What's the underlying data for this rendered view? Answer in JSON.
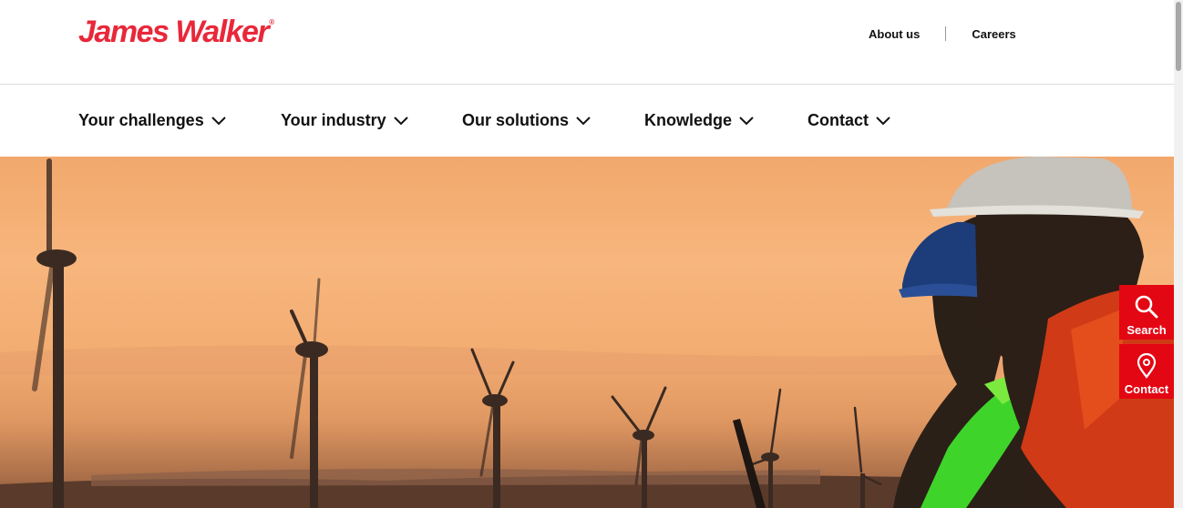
{
  "brand": {
    "logo_text": "James Walker",
    "logo_mark": "®",
    "color": "#e8283a"
  },
  "utility_nav": {
    "about": "About us",
    "careers": "Careers"
  },
  "main_nav": [
    {
      "label": "Your challenges",
      "icon": "chevron-down-icon"
    },
    {
      "label": "Your industry",
      "icon": "chevron-down-icon"
    },
    {
      "label": "Our solutions",
      "icon": "chevron-down-icon"
    },
    {
      "label": "Knowledge",
      "icon": "chevron-down-icon"
    },
    {
      "label": "Contact",
      "icon": "chevron-down-icon"
    }
  ],
  "floating_actions": {
    "search": {
      "label": "Search",
      "icon": "search-icon"
    },
    "contact": {
      "label": "Contact",
      "icon": "map-pin-icon"
    },
    "color": "#e30613"
  }
}
